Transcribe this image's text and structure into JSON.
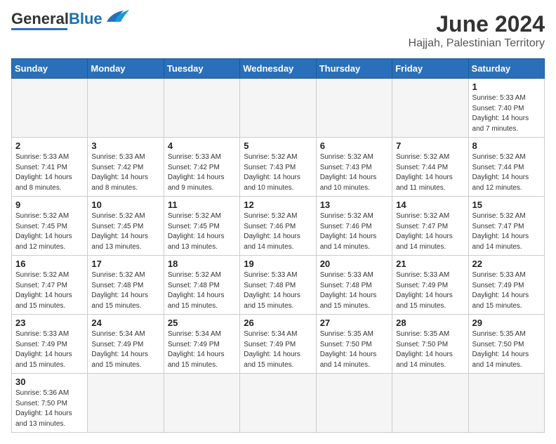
{
  "header": {
    "logo_general": "General",
    "logo_blue": "Blue",
    "month_title": "June 2024",
    "location": "Hajjah, Palestinian Territory"
  },
  "weekdays": [
    "Sunday",
    "Monday",
    "Tuesday",
    "Wednesday",
    "Thursday",
    "Friday",
    "Saturday"
  ],
  "days": [
    {
      "num": "",
      "info": ""
    },
    {
      "num": "",
      "info": ""
    },
    {
      "num": "",
      "info": ""
    },
    {
      "num": "",
      "info": ""
    },
    {
      "num": "",
      "info": ""
    },
    {
      "num": "",
      "info": ""
    },
    {
      "num": "1",
      "info": "Sunrise: 5:33 AM\nSunset: 7:40 PM\nDaylight: 14 hours\nand 7 minutes."
    },
    {
      "num": "2",
      "info": "Sunrise: 5:33 AM\nSunset: 7:41 PM\nDaylight: 14 hours\nand 8 minutes."
    },
    {
      "num": "3",
      "info": "Sunrise: 5:33 AM\nSunset: 7:42 PM\nDaylight: 14 hours\nand 8 minutes."
    },
    {
      "num": "4",
      "info": "Sunrise: 5:33 AM\nSunset: 7:42 PM\nDaylight: 14 hours\nand 9 minutes."
    },
    {
      "num": "5",
      "info": "Sunrise: 5:32 AM\nSunset: 7:43 PM\nDaylight: 14 hours\nand 10 minutes."
    },
    {
      "num": "6",
      "info": "Sunrise: 5:32 AM\nSunset: 7:43 PM\nDaylight: 14 hours\nand 10 minutes."
    },
    {
      "num": "7",
      "info": "Sunrise: 5:32 AM\nSunset: 7:44 PM\nDaylight: 14 hours\nand 11 minutes."
    },
    {
      "num": "8",
      "info": "Sunrise: 5:32 AM\nSunset: 7:44 PM\nDaylight: 14 hours\nand 12 minutes."
    },
    {
      "num": "9",
      "info": "Sunrise: 5:32 AM\nSunset: 7:45 PM\nDaylight: 14 hours\nand 12 minutes."
    },
    {
      "num": "10",
      "info": "Sunrise: 5:32 AM\nSunset: 7:45 PM\nDaylight: 14 hours\nand 13 minutes."
    },
    {
      "num": "11",
      "info": "Sunrise: 5:32 AM\nSunset: 7:45 PM\nDaylight: 14 hours\nand 13 minutes."
    },
    {
      "num": "12",
      "info": "Sunrise: 5:32 AM\nSunset: 7:46 PM\nDaylight: 14 hours\nand 14 minutes."
    },
    {
      "num": "13",
      "info": "Sunrise: 5:32 AM\nSunset: 7:46 PM\nDaylight: 14 hours\nand 14 minutes."
    },
    {
      "num": "14",
      "info": "Sunrise: 5:32 AM\nSunset: 7:47 PM\nDaylight: 14 hours\nand 14 minutes."
    },
    {
      "num": "15",
      "info": "Sunrise: 5:32 AM\nSunset: 7:47 PM\nDaylight: 14 hours\nand 14 minutes."
    },
    {
      "num": "16",
      "info": "Sunrise: 5:32 AM\nSunset: 7:47 PM\nDaylight: 14 hours\nand 15 minutes."
    },
    {
      "num": "17",
      "info": "Sunrise: 5:32 AM\nSunset: 7:48 PM\nDaylight: 14 hours\nand 15 minutes."
    },
    {
      "num": "18",
      "info": "Sunrise: 5:32 AM\nSunset: 7:48 PM\nDaylight: 14 hours\nand 15 minutes."
    },
    {
      "num": "19",
      "info": "Sunrise: 5:33 AM\nSunset: 7:48 PM\nDaylight: 14 hours\nand 15 minutes."
    },
    {
      "num": "20",
      "info": "Sunrise: 5:33 AM\nSunset: 7:48 PM\nDaylight: 14 hours\nand 15 minutes."
    },
    {
      "num": "21",
      "info": "Sunrise: 5:33 AM\nSunset: 7:49 PM\nDaylight: 14 hours\nand 15 minutes."
    },
    {
      "num": "22",
      "info": "Sunrise: 5:33 AM\nSunset: 7:49 PM\nDaylight: 14 hours\nand 15 minutes."
    },
    {
      "num": "23",
      "info": "Sunrise: 5:33 AM\nSunset: 7:49 PM\nDaylight: 14 hours\nand 15 minutes."
    },
    {
      "num": "24",
      "info": "Sunrise: 5:34 AM\nSunset: 7:49 PM\nDaylight: 14 hours\nand 15 minutes."
    },
    {
      "num": "25",
      "info": "Sunrise: 5:34 AM\nSunset: 7:49 PM\nDaylight: 14 hours\nand 15 minutes."
    },
    {
      "num": "26",
      "info": "Sunrise: 5:34 AM\nSunset: 7:49 PM\nDaylight: 14 hours\nand 15 minutes."
    },
    {
      "num": "27",
      "info": "Sunrise: 5:35 AM\nSunset: 7:50 PM\nDaylight: 14 hours\nand 14 minutes."
    },
    {
      "num": "28",
      "info": "Sunrise: 5:35 AM\nSunset: 7:50 PM\nDaylight: 14 hours\nand 14 minutes."
    },
    {
      "num": "29",
      "info": "Sunrise: 5:35 AM\nSunset: 7:50 PM\nDaylight: 14 hours\nand 14 minutes."
    },
    {
      "num": "30",
      "info": "Sunrise: 5:36 AM\nSunset: 7:50 PM\nDaylight: 14 hours\nand 13 minutes."
    }
  ]
}
